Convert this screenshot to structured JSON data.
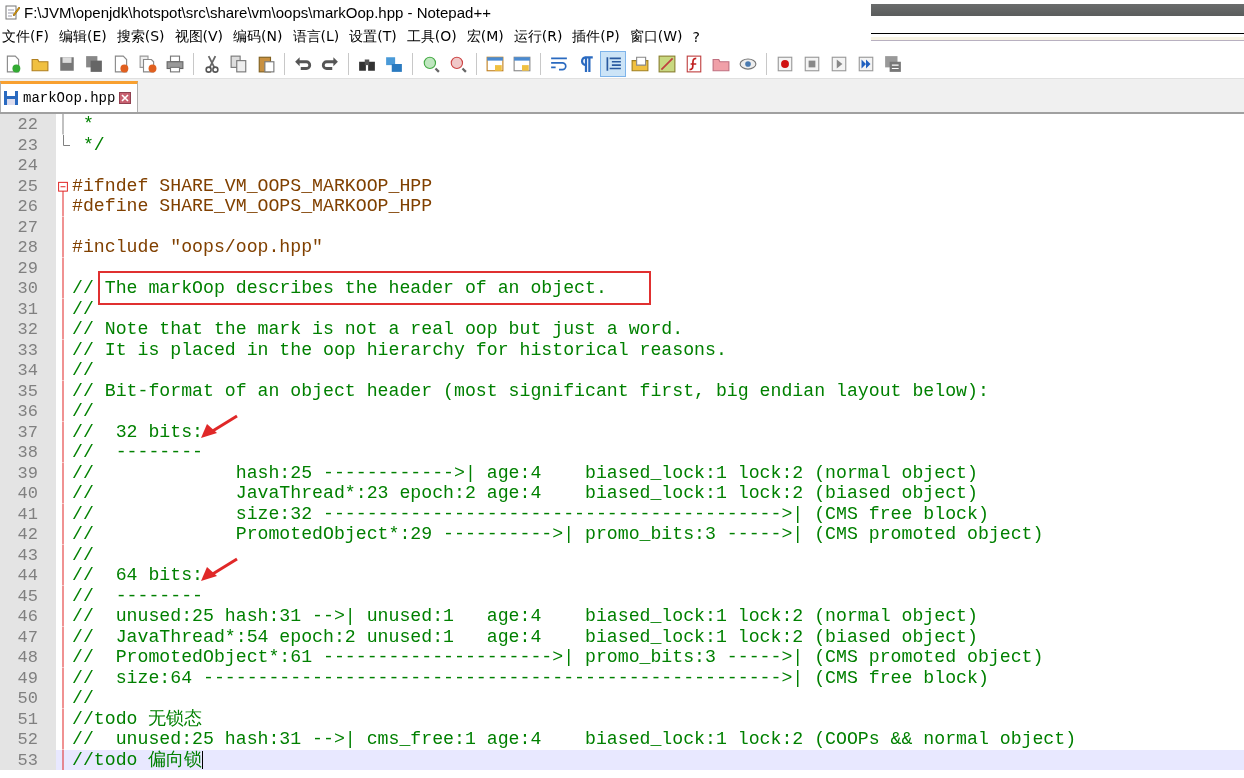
{
  "window": {
    "title": "F:\\JVM\\openjdk\\hotspot\\src\\share\\vm\\oops\\markOop.hpp - Notepad++"
  },
  "menu": [
    {
      "label": "文件(F)"
    },
    {
      "label": "编辑(E)"
    },
    {
      "label": "搜索(S)"
    },
    {
      "label": "视图(V)"
    },
    {
      "label": "编码(N)"
    },
    {
      "label": "语言(L)"
    },
    {
      "label": "设置(T)"
    },
    {
      "label": "工具(O)"
    },
    {
      "label": "宏(M)"
    },
    {
      "label": "运行(R)"
    },
    {
      "label": "插件(P)"
    },
    {
      "label": "窗口(W)"
    },
    {
      "label": "?"
    }
  ],
  "toolbar": [
    {
      "kind": "button",
      "pressed": false
    },
    {
      "kind": "button",
      "pressed": false
    },
    {
      "kind": "button",
      "pressed": false
    },
    {
      "kind": "button",
      "pressed": false
    },
    {
      "kind": "button",
      "pressed": false
    },
    {
      "kind": "button",
      "pressed": false
    },
    {
      "kind": "button",
      "pressed": false
    },
    {
      "kind": "separator"
    },
    {
      "kind": "button",
      "pressed": false
    },
    {
      "kind": "button",
      "pressed": false
    },
    {
      "kind": "button",
      "pressed": false
    },
    {
      "kind": "separator"
    },
    {
      "kind": "button",
      "pressed": false
    },
    {
      "kind": "button",
      "pressed": false
    },
    {
      "kind": "separator"
    },
    {
      "kind": "button",
      "pressed": false
    },
    {
      "kind": "button",
      "pressed": false
    },
    {
      "kind": "separator"
    },
    {
      "kind": "button",
      "pressed": false
    },
    {
      "kind": "button",
      "pressed": false
    },
    {
      "kind": "separator"
    },
    {
      "kind": "button",
      "pressed": false
    },
    {
      "kind": "button",
      "pressed": false
    },
    {
      "kind": "separator"
    },
    {
      "kind": "button",
      "pressed": false
    },
    {
      "kind": "button",
      "pressed": false
    },
    {
      "kind": "button",
      "pressed": true
    },
    {
      "kind": "button",
      "pressed": false
    },
    {
      "kind": "button",
      "pressed": false
    },
    {
      "kind": "button",
      "pressed": false
    },
    {
      "kind": "button",
      "pressed": false
    },
    {
      "kind": "button",
      "pressed": false
    },
    {
      "kind": "separator"
    },
    {
      "kind": "button",
      "pressed": false
    },
    {
      "kind": "button",
      "pressed": false
    },
    {
      "kind": "button",
      "pressed": false
    },
    {
      "kind": "button",
      "pressed": false
    },
    {
      "kind": "button",
      "pressed": false
    }
  ],
  "tabs": [
    {
      "label": "markOop.hpp",
      "selected": true
    }
  ],
  "lines": [
    {
      "number": "22",
      "fold": {
        "kind": "line",
        "active": false
      },
      "segments": [
        {
          "text": " *",
          "kind": "comment"
        }
      ]
    },
    {
      "number": "23",
      "fold": {
        "kind": "end",
        "active": false
      },
      "segments": [
        {
          "text": " */",
          "kind": "comment"
        }
      ]
    },
    {
      "number": "24"
    },
    {
      "number": "25",
      "fold": {
        "kind": "start",
        "active": true
      },
      "segments": [
        {
          "text": "#ifndef SHARE_VM_OOPS_MARKOOP_HPP",
          "kind": "preprocessor"
        }
      ]
    },
    {
      "number": "26",
      "fold": {
        "kind": "line",
        "active": true
      },
      "segments": [
        {
          "text": "#define SHARE_VM_OOPS_MARKOOP_HPP",
          "kind": "preprocessor"
        }
      ]
    },
    {
      "number": "27",
      "fold": {
        "kind": "line",
        "active": true
      }
    },
    {
      "number": "28",
      "fold": {
        "kind": "line",
        "active": true
      },
      "segments": [
        {
          "text": "#include \"oops/oop.hpp\"",
          "kind": "preprocessor"
        }
      ]
    },
    {
      "number": "29",
      "fold": {
        "kind": "line",
        "active": true
      }
    },
    {
      "number": "30",
      "fold": {
        "kind": "line",
        "active": true
      },
      "segments": [
        {
          "text": "// ",
          "kind": "comment"
        },
        {
          "text": "The markOop describes the header of an object.",
          "kind": "comment",
          "boxed": true
        }
      ]
    },
    {
      "number": "31",
      "fold": {
        "kind": "line",
        "active": true
      },
      "segments": [
        {
          "text": "//",
          "kind": "comment"
        }
      ]
    },
    {
      "number": "32",
      "fold": {
        "kind": "line",
        "active": true
      },
      "segments": [
        {
          "text": "// Note that the mark is not a real oop but just a word.",
          "kind": "comment"
        }
      ]
    },
    {
      "number": "33",
      "fold": {
        "kind": "line",
        "active": true
      },
      "segments": [
        {
          "text": "// It is placed in the oop hierarchy for historical reasons.",
          "kind": "comment"
        }
      ]
    },
    {
      "number": "34",
      "fold": {
        "kind": "line",
        "active": true
      },
      "segments": [
        {
          "text": "//",
          "kind": "comment"
        }
      ]
    },
    {
      "number": "35",
      "fold": {
        "kind": "line",
        "active": true
      },
      "segments": [
        {
          "text": "// Bit-format of an object header (most significant first, big endian layout below):",
          "kind": "comment"
        }
      ]
    },
    {
      "number": "36",
      "fold": {
        "kind": "line",
        "active": true
      },
      "segments": [
        {
          "text": "//",
          "kind": "comment"
        }
      ]
    },
    {
      "number": "37",
      "fold": {
        "kind": "line",
        "active": true
      },
      "arrow": true,
      "segments": [
        {
          "text": "//  32 bits:",
          "kind": "comment"
        }
      ]
    },
    {
      "number": "38",
      "fold": {
        "kind": "line",
        "active": true
      },
      "segments": [
        {
          "text": "//  --------",
          "kind": "comment"
        }
      ]
    },
    {
      "number": "39",
      "fold": {
        "kind": "line",
        "active": true
      },
      "segments": [
        {
          "text": "//             hash:25 ------------>| age:4    biased_lock:1 lock:2 (normal object)",
          "kind": "comment"
        }
      ]
    },
    {
      "number": "40",
      "fold": {
        "kind": "line",
        "active": true
      },
      "segments": [
        {
          "text": "//             JavaThread*:23 epoch:2 age:4    biased_lock:1 lock:2 (biased object)",
          "kind": "comment"
        }
      ]
    },
    {
      "number": "41",
      "fold": {
        "kind": "line",
        "active": true
      },
      "segments": [
        {
          "text": "//             size:32 ------------------------------------------>| (CMS free block)",
          "kind": "comment"
        }
      ]
    },
    {
      "number": "42",
      "fold": {
        "kind": "line",
        "active": true
      },
      "segments": [
        {
          "text": "//             PromotedObject*:29 ---------->| promo_bits:3 ----->| (CMS promoted object)",
          "kind": "comment"
        }
      ]
    },
    {
      "number": "43",
      "fold": {
        "kind": "line",
        "active": true
      },
      "segments": [
        {
          "text": "//",
          "kind": "comment"
        }
      ]
    },
    {
      "number": "44",
      "fold": {
        "kind": "line",
        "active": true
      },
      "arrow": true,
      "segments": [
        {
          "text": "//  64 bits:",
          "kind": "comment"
        }
      ]
    },
    {
      "number": "45",
      "fold": {
        "kind": "line",
        "active": true
      },
      "segments": [
        {
          "text": "//  --------",
          "kind": "comment"
        }
      ]
    },
    {
      "number": "46",
      "fold": {
        "kind": "line",
        "active": true
      },
      "segments": [
        {
          "text": "//  unused:25 hash:31 -->| unused:1   age:4    biased_lock:1 lock:2 (normal object)",
          "kind": "comment"
        }
      ]
    },
    {
      "number": "47",
      "fold": {
        "kind": "line",
        "active": true
      },
      "segments": [
        {
          "text": "//  JavaThread*:54 epoch:2 unused:1   age:4    biased_lock:1 lock:2 (biased object)",
          "kind": "comment"
        }
      ]
    },
    {
      "number": "48",
      "fold": {
        "kind": "line",
        "active": true
      },
      "segments": [
        {
          "text": "//  PromotedObject*:61 --------------------->| promo_bits:3 ----->| (CMS promoted object)",
          "kind": "comment"
        }
      ]
    },
    {
      "number": "49",
      "fold": {
        "kind": "line",
        "active": true
      },
      "segments": [
        {
          "text": "//  size:64 ----------------------------------------------------->| (CMS free block)",
          "kind": "comment"
        }
      ]
    },
    {
      "number": "50",
      "fold": {
        "kind": "line",
        "active": true
      },
      "segments": [
        {
          "text": "//",
          "kind": "comment"
        }
      ]
    },
    {
      "number": "51",
      "fold": {
        "kind": "line",
        "active": true
      },
      "segments": [
        {
          "text": "//todo 无锁态",
          "kind": "comment"
        }
      ]
    },
    {
      "number": "52",
      "fold": {
        "kind": "line",
        "active": true
      },
      "segments": [
        {
          "text": "//  unused:25 hash:31 -->| cms_free:1 age:4    biased_lock:1 lock:2 (COOPs && normal object)",
          "kind": "comment"
        }
      ]
    },
    {
      "number": "53",
      "fold": {
        "kind": "line",
        "active": true
      },
      "current": true,
      "segments": [
        {
          "text": "//todo 偏向锁",
          "kind": "comment"
        }
      ]
    }
  ]
}
